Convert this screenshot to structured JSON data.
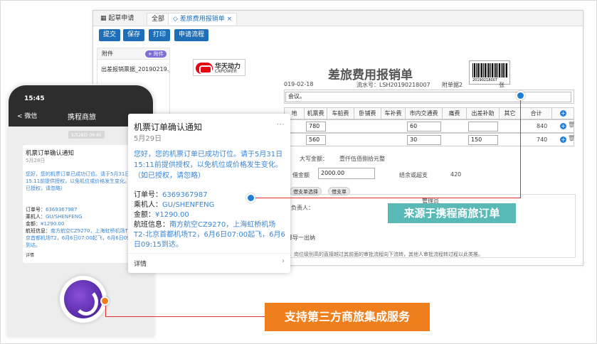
{
  "window": {
    "tabs": [
      "起草申请",
      "全部",
      "差旅费用报销单"
    ],
    "toolbar": [
      "提交",
      "保存",
      "打印",
      "申请流程"
    ],
    "attachments": {
      "header": "附件",
      "add_label": "+ 附件",
      "file": "出差报销票据_20190219.j..."
    }
  },
  "form": {
    "logo_cn": "华天动力",
    "logo_en": "CNPOWER",
    "title": "差旅费用报销单",
    "barcode_number": "20190218007",
    "date": "019-02-18",
    "serial": "流水号：LSH20190218007",
    "attach_count": "附单据2",
    "attach_unit": "张",
    "purpose": "会议。",
    "columns": [
      "地",
      "机票费",
      "车船费",
      "卧铺费",
      "车补费",
      "市内交通费",
      "痛费",
      "出差补助",
      "其它",
      "合计"
    ],
    "rows": [
      {
        "plane": "780",
        "city": "60",
        "subsidy": "",
        "total": "840"
      },
      {
        "plane": "560",
        "city": "30",
        "subsidy": "150",
        "total": "740"
      }
    ],
    "capital_label": "大写金额：",
    "capital_value": "壹仟伍佰捌拾元整",
    "loan_label": "借金额",
    "loan_value": "2000.00",
    "balance_label": "结余或超支",
    "balance_value": "420",
    "pill1": "借支单选择",
    "pill2": "借支单",
    "principal_label": "负责人：",
    "mgr_label": "管理员",
    "finance_label": "审批",
    "approve_label": "部导一出纳",
    "note": "位，岗位级别高的直接越过其前面的审批流程向下流转，其他人审批流程转过程以此类推。"
  },
  "phone": {
    "time": "15:45",
    "back": "< 微信",
    "title": "携程商旅",
    "msg_time": "5月28日 09:45",
    "card": {
      "title": "机票订单确认通知",
      "date": "5月28日",
      "message": "您好，您的机票订单已成功订位。请于5月31日15:11前提供授权，以免机位或价格发生变化。（如已授权，请忽略）",
      "order_label": "订单号：",
      "order": "6369367987",
      "passenger_label": "乘机人：",
      "passenger": "GU/SHENFENG",
      "amount_label": "金额：",
      "amount": "¥1290.00",
      "flight_label": "航班信息：",
      "flight": "南方航空CZ9270，上海虹桥机场T2-北京首都机场T2，6月6日07:00起飞，6月6日09:15到达。",
      "detail": "详情"
    }
  },
  "popup": {
    "title": "机票订单确认通知",
    "date": "5月29日",
    "message": "您好，您的机票订单已成功订位。请于5月31日15:11前提供授权，以免机位或价格发生变化。（如已授权，请忽略）",
    "order_label": "订单号：",
    "order": "6369367987",
    "passenger_label": "乘机人：",
    "passenger": "GU/SHENFENG",
    "amount_label": "金额：",
    "amount": "¥1290.00",
    "flight_label": "航班信息：",
    "flight": "南方航空CZ9270，上海虹桥机场T2-北京首都机场T2，6月6日07:00起飞，6月6日09:15到达。",
    "detail": "详情"
  },
  "callouts": {
    "blue": "来源于携程商旅订单",
    "orange": "支持第三方商旅集成服务",
    "blue_color": "#59b9b6",
    "orange_color": "#ef7e1d"
  }
}
